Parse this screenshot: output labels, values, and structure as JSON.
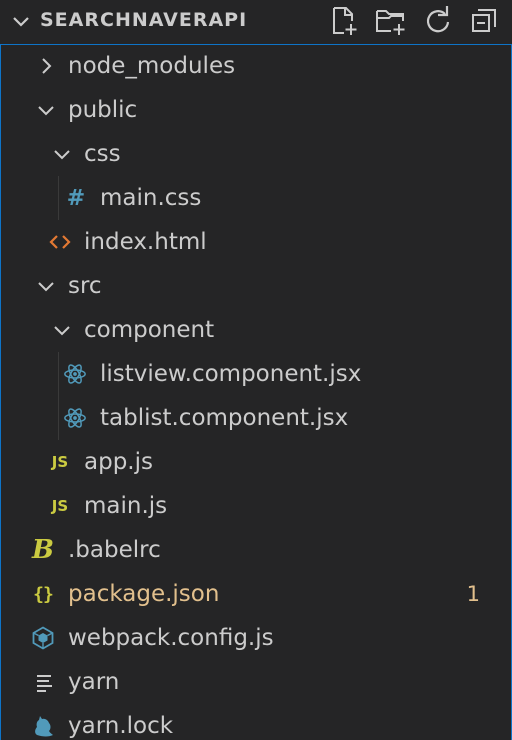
{
  "explorer": {
    "title": "SEARCHNAVERAPI",
    "actions": [
      {
        "name": "new-file-icon"
      },
      {
        "name": "new-folder-icon"
      },
      {
        "name": "refresh-icon"
      },
      {
        "name": "collapse-all-icon"
      }
    ]
  },
  "tree": {
    "node_modules": "node_modules",
    "public": "public",
    "css": "css",
    "main_css": "main.css",
    "index_html": "index.html",
    "src": "src",
    "component": "component",
    "listview": "listview.component.jsx",
    "tablist": "tablist.component.jsx",
    "app_js": "app.js",
    "main_js": "main.js",
    "babelrc": ".babelrc",
    "package_json": "package.json",
    "package_json_badge": "1",
    "webpack": "webpack.config.js",
    "yarn": "yarn",
    "yarn_lock": "yarn.lock"
  },
  "icons": {
    "js_text": "JS",
    "hash_text": "#",
    "babel_text": "B",
    "json_text": "{}"
  },
  "colors": {
    "background": "#252526",
    "text": "#cccccc",
    "focus_border": "#0e74c8",
    "js_yellow": "#cbcb41",
    "css_blue": "#519aba",
    "html_orange": "#e37933",
    "react_blue": "#519aba",
    "modified": "#e2c08d"
  }
}
